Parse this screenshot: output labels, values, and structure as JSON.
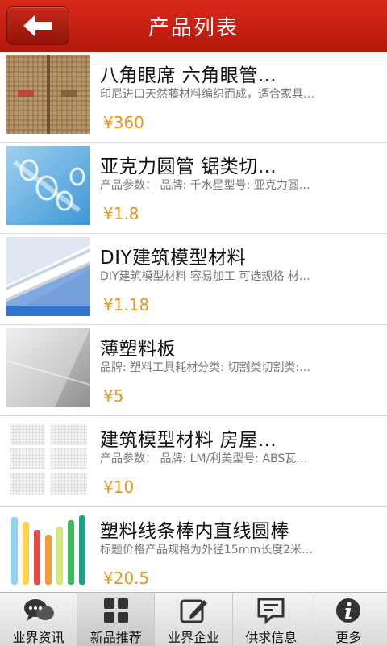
{
  "header": {
    "title": "产品列表",
    "back_icon": "arrow-left-icon"
  },
  "products": [
    {
      "title": "八角眼席 六角眼管…",
      "desc": "印尼进口天然藤材料编织而成，适合家具…",
      "price": "¥360"
    },
    {
      "title": "亚克力圆管 锯类切…",
      "desc": "产品参数： 品牌: 千水星型号: 亚克力圆…",
      "price": "¥1.8"
    },
    {
      "title": "DIY建筑模型材料",
      "desc": "DIY建筑模型材料 容易加工 可选规格 材…",
      "price": "¥1.18"
    },
    {
      "title": "薄塑料板",
      "desc": "品牌: 塑料工具耗材分类: 切割类切割类:…",
      "price": "¥5"
    },
    {
      "title": "建筑模型材料 房屋…",
      "desc": "产品参数： 品牌: LM/利美型号: ABS瓦…",
      "price": "¥10"
    },
    {
      "title": "塑料线条棒内直线圆棒",
      "desc": "标题价格产品规格为外径15mm长度2米…",
      "price": "¥20.5"
    }
  ],
  "tabs": [
    {
      "label": "业界资讯",
      "icon": "chat-bubbles-icon",
      "active": false
    },
    {
      "label": "新品推荐",
      "icon": "grid-icon",
      "active": true
    },
    {
      "label": "业界企业",
      "icon": "edit-icon",
      "active": false
    },
    {
      "label": "供求信息",
      "icon": "message-icon",
      "active": false
    },
    {
      "label": "更多",
      "icon": "info-icon",
      "active": false
    }
  ],
  "colors": {
    "header_red": "#c8200f",
    "price_orange": "#e8961c"
  }
}
